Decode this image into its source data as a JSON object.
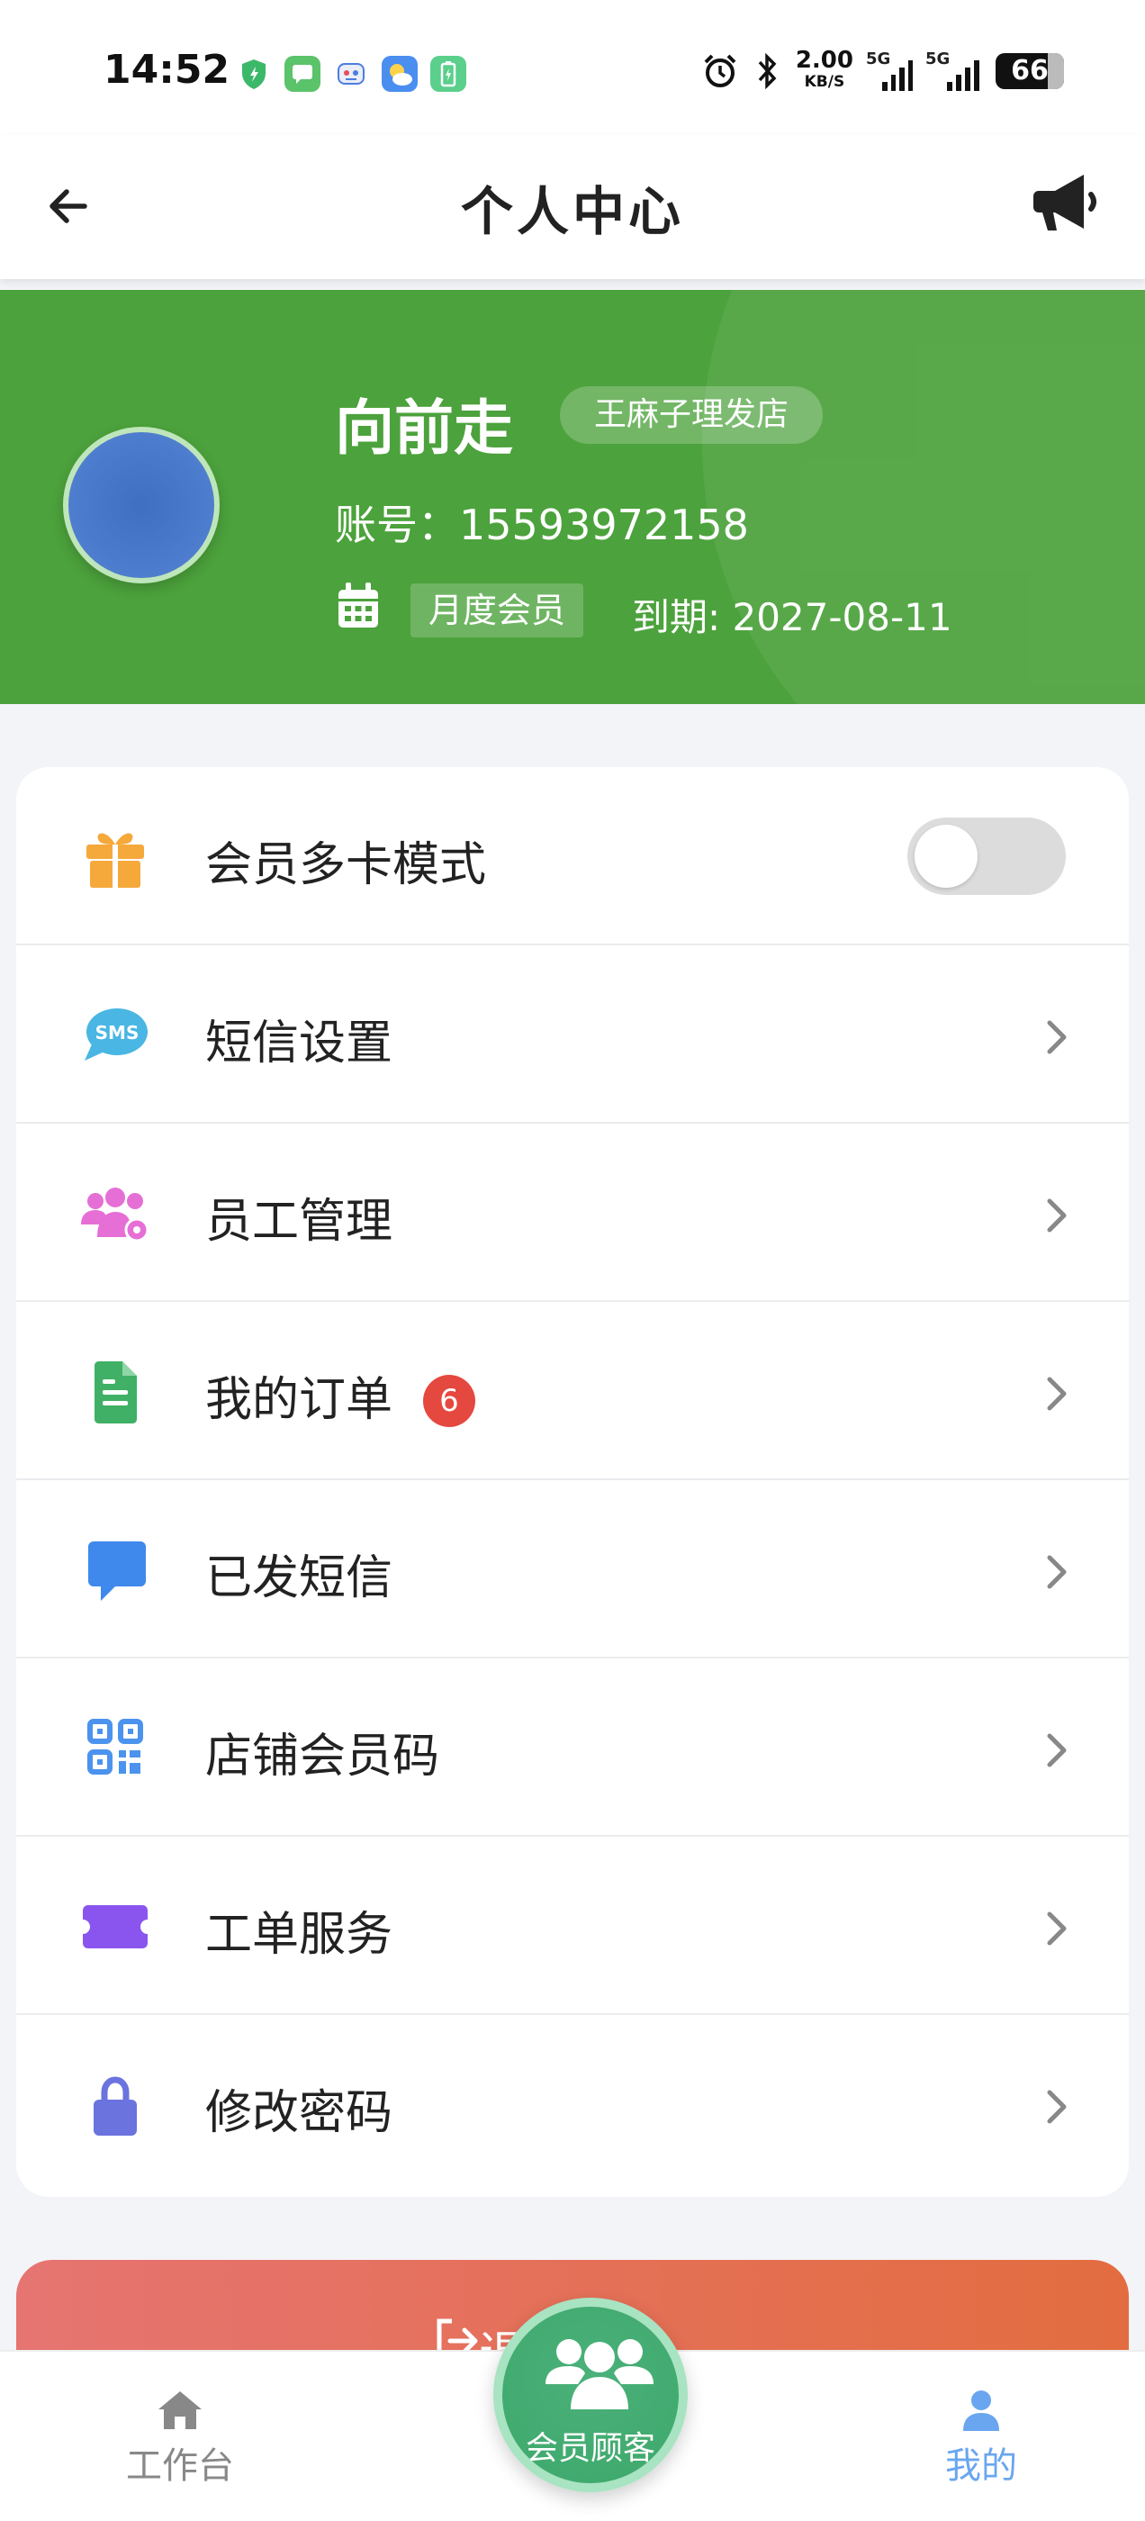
{
  "status_bar": {
    "time": "14:52",
    "net_speed_value": "2.00",
    "net_speed_unit": "KB/S",
    "signal_1": "5G",
    "signal_2": "5G",
    "battery": "66"
  },
  "header": {
    "title": "个人中心",
    "back_icon": "arrow-left-icon",
    "action_icon": "megaphone-icon"
  },
  "profile": {
    "name": "向前走",
    "store": "王麻子理发店",
    "account": "账号：15593972158",
    "membership_level": "月度会员",
    "expire": "到期: 2027-08-11"
  },
  "menu": {
    "items": [
      {
        "label": "会员多卡模式",
        "icon": "gift-icon",
        "color": "#f5a93b",
        "type": "toggle",
        "toggle_on": false
      },
      {
        "label": "短信设置",
        "icon": "sms-icon",
        "color": "#49b6e3",
        "type": "link"
      },
      {
        "label": "员工管理",
        "icon": "staff-settings-icon",
        "color": "#e66fd6",
        "type": "link"
      },
      {
        "label": "我的订单",
        "icon": "document-icon",
        "color": "#3fb065",
        "type": "link",
        "badge": "6"
      },
      {
        "label": "已发短信",
        "icon": "chat-bubble-icon",
        "color": "#3f88ec",
        "type": "link"
      },
      {
        "label": "店铺会员码",
        "icon": "qr-code-icon",
        "color": "#4b93ee",
        "type": "link"
      },
      {
        "label": "工单服务",
        "icon": "ticket-icon",
        "color": "#8a55ee",
        "type": "link"
      },
      {
        "label": "修改密码",
        "icon": "lock-icon",
        "color": "#6a73de",
        "type": "link"
      }
    ]
  },
  "logout": {
    "label": "退出登录",
    "icon": "logout-icon"
  },
  "tabbar": {
    "work": "工作台",
    "center": "会员顾客",
    "mine": "我的",
    "active": "mine"
  },
  "colors": {
    "brand_green": "#4ca23c",
    "active_tab": "#6aa6ef",
    "badge_red": "#e5483f"
  }
}
